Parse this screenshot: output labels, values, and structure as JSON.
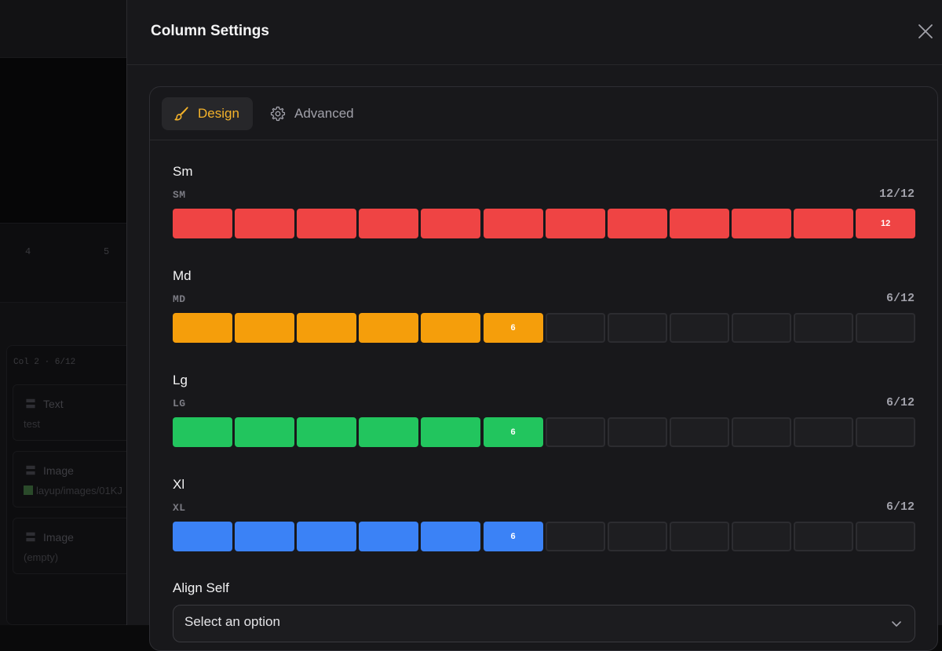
{
  "background": {
    "grid_numbers": [
      "4",
      "5"
    ],
    "column_label": "Col 2 · 6/12",
    "items": [
      {
        "title": "Text",
        "sub": "test"
      },
      {
        "title": "Image",
        "sub": "layup/images/01KJ"
      },
      {
        "title": "Image",
        "sub": "(empty)"
      }
    ]
  },
  "drawer": {
    "title": "Column Settings",
    "close_icon": "close-icon"
  },
  "tabs": [
    {
      "label": "Design",
      "icon": "paintbrush-icon",
      "active": true
    },
    {
      "label": "Advanced",
      "icon": "gear-icon",
      "active": false
    }
  ],
  "breakpoints": [
    {
      "title": "Sm",
      "code": "SM",
      "ratio": "12/12",
      "span": 12,
      "total": 12,
      "color": "#ef4444",
      "selected_label": "12"
    },
    {
      "title": "Md",
      "code": "MD",
      "ratio": "6/12",
      "span": 6,
      "total": 12,
      "color": "#f59e0b",
      "selected_label": "6"
    },
    {
      "title": "Lg",
      "code": "LG",
      "ratio": "6/12",
      "span": 6,
      "total": 12,
      "color": "#22c55e",
      "selected_label": "6"
    },
    {
      "title": "Xl",
      "code": "XL",
      "ratio": "6/12",
      "span": 6,
      "total": 12,
      "color": "#3b82f6",
      "selected_label": "6"
    }
  ],
  "align_self": {
    "label": "Align Self",
    "placeholder": "Select an option"
  }
}
